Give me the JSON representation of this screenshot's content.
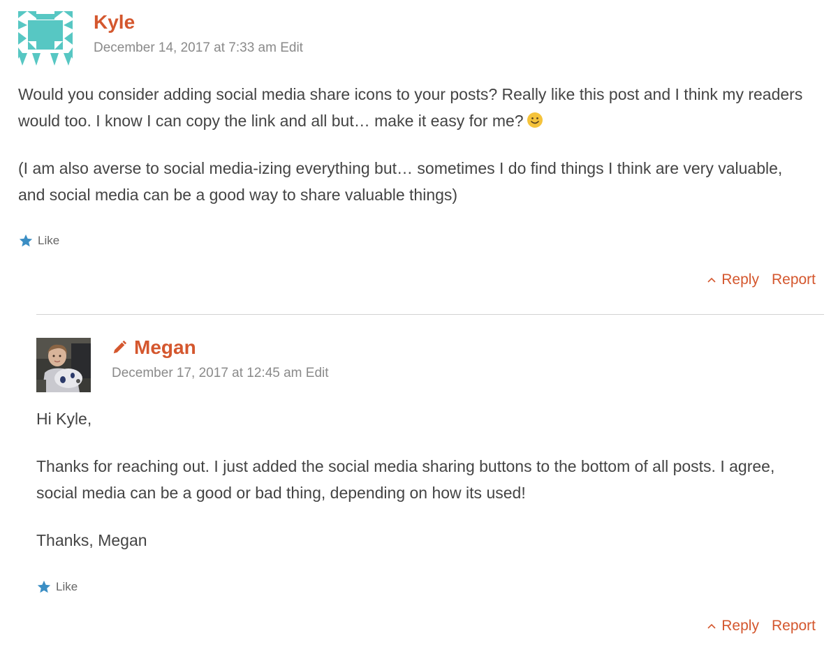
{
  "comments": [
    {
      "author": "Kyle",
      "date": "December 14, 2017 at 7:33 am",
      "edit_label": "Edit",
      "paragraphs": [
        "Would you consider adding social media share icons to your posts? Really like this post and I think my readers would too. I know I can copy the link and all but… make it easy for me?",
        "(I am also averse to social media-izing everything but… sometimes I do find things I think are very valuable, and social media can be a good way to share valuable things)"
      ],
      "like_label": "Like",
      "reply_label": "Reply",
      "report_label": "Report"
    },
    {
      "author": "Megan",
      "date": "December 17, 2017 at 12:45 am",
      "edit_label": "Edit",
      "paragraphs": [
        "Hi Kyle,",
        "Thanks for reaching out. I just added the social media sharing buttons to the bottom of all posts. I agree, social media can be a good or bad thing, depending on how its used!",
        "Thanks, Megan"
      ],
      "like_label": "Like",
      "reply_label": "Reply",
      "report_label": "Report"
    }
  ],
  "colors": {
    "accent": "#d4572e",
    "meta_text": "#8a8a8a",
    "body_text": "#444444",
    "like_star": "#3b8ec4",
    "identicon": "#57c7c3",
    "divider": "#d2d2d2"
  },
  "icons": {
    "like": "star-icon",
    "reply": "chevron-up-icon",
    "author_badge": "pencil-icon",
    "emoji": "smiley-icon"
  }
}
